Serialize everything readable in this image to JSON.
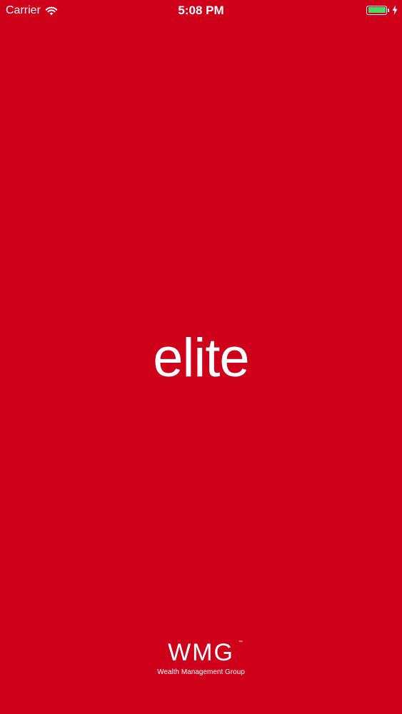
{
  "status_bar": {
    "carrier": "Carrier",
    "time": "5:08 PM",
    "wifi_icon": "wifi-icon",
    "battery_level": 1.0,
    "battery_charging": true,
    "battery_color": "#4cd964"
  },
  "splash": {
    "logo_text": "elite",
    "brand": "WMG",
    "brand_trademark": "™",
    "brand_tagline": "Wealth Management Group"
  },
  "colors": {
    "background": "#cf0019",
    "foreground": "#ffffff"
  }
}
